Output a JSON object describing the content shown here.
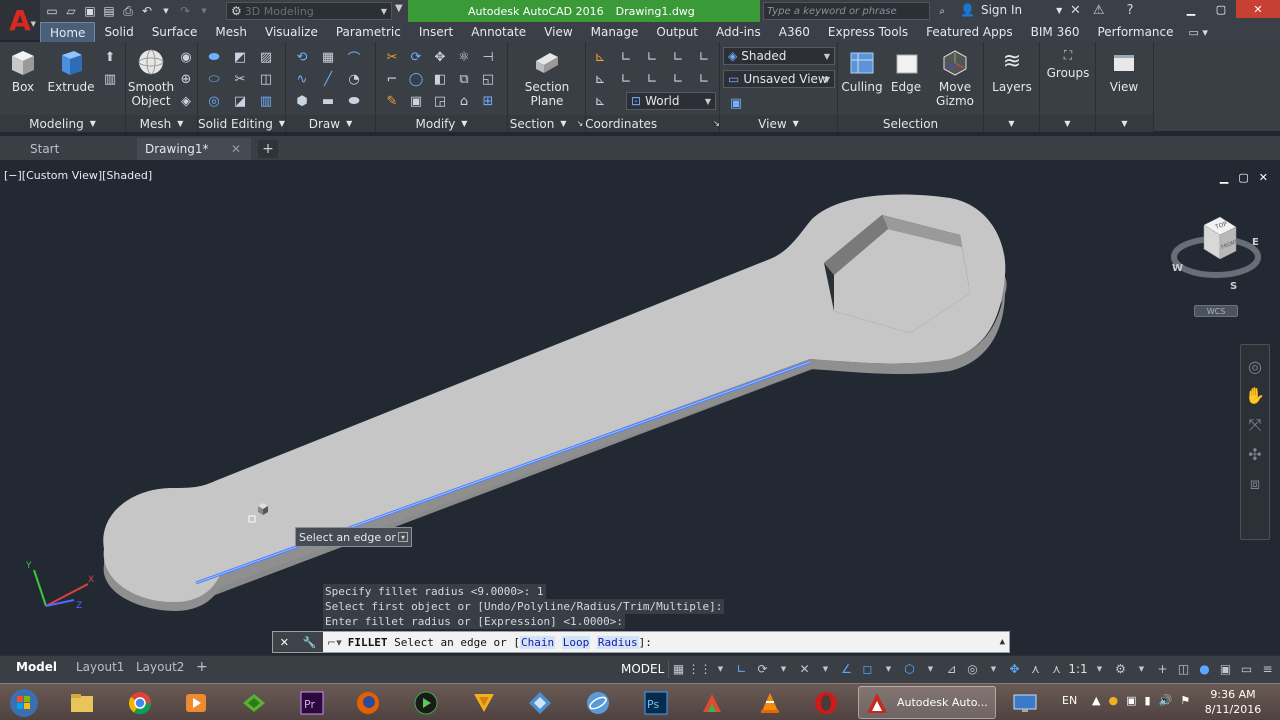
{
  "titlebar": {
    "workspace": "3D Modeling",
    "app_name": "Autodesk AutoCAD 2016",
    "file_name": "Drawing1.dwg",
    "search_placeholder": "Type a keyword or phrase",
    "sign_in": "Sign In"
  },
  "ribbon_tabs": [
    "Home",
    "Solid",
    "Surface",
    "Mesh",
    "Visualize",
    "Parametric",
    "Insert",
    "Annotate",
    "View",
    "Manage",
    "Output",
    "Add-ins",
    "A360",
    "Express Tools",
    "Featured Apps",
    "BIM 360",
    "Performance"
  ],
  "panels": {
    "modeling": {
      "title": "Modeling",
      "box": "Box",
      "extrude": "Extrude"
    },
    "mesh": {
      "title": "Mesh",
      "smooth_1": "Smooth",
      "smooth_2": "Object"
    },
    "solid_editing": {
      "title": "Solid Editing"
    },
    "draw": {
      "title": "Draw"
    },
    "modify": {
      "title": "Modify"
    },
    "section": {
      "title": "Section",
      "plane_1": "Section",
      "plane_2": "Plane"
    },
    "coordinates": {
      "title": "Coordinates",
      "world": "World"
    },
    "view": {
      "title": "View",
      "visual_style": "Shaded",
      "named_view": "Unsaved View"
    },
    "selection": {
      "title": "Selection",
      "culling": "Culling",
      "edge": "Edge",
      "gizmo_1": "Move",
      "gizmo_2": "Gizmo"
    },
    "layers": {
      "label": "Layers"
    },
    "groups": {
      "label": "Groups"
    },
    "view_big": {
      "label": "View"
    }
  },
  "file_tabs": {
    "start": "Start",
    "drawing": "Drawing1*"
  },
  "viewport": {
    "label": "[−][Custom View][Shaded]",
    "viewcube_top": "TOP",
    "viewcube_front": "FRONT",
    "compass_w": "W",
    "compass_e": "E",
    "compass_s": "S",
    "wcs": "WCS",
    "ucs_y": "Y",
    "ucs_x": "X",
    "ucs_z": "Z"
  },
  "tooltip": "Select an edge or",
  "command_history": [
    "Specify fillet radius <9.0000>: 1",
    "Select first object or [Undo/Polyline/Radius/Trim/Multiple]:",
    "Enter fillet radius or [Expression] <1.0000>:"
  ],
  "command_line": {
    "command": "FILLET",
    "prompt": "Select an edge or [",
    "opt_chain": "Chain",
    "opt_loop": "Loop",
    "opt_radius": "Radius",
    "suffix": "]:"
  },
  "layout_tabs": {
    "model": "Model",
    "layout1": "Layout1",
    "layout2": "Layout2"
  },
  "status": {
    "model": "MODEL",
    "scale": "1:1"
  },
  "taskbar": {
    "autocad_task": "Autodesk Auto...",
    "lang": "EN",
    "time": "9:36 AM",
    "date": "8/11/2016"
  },
  "colors": {
    "accent": "#3a9a38",
    "selection_edge": "#4a7fff",
    "viewport_bg": "#222932"
  }
}
